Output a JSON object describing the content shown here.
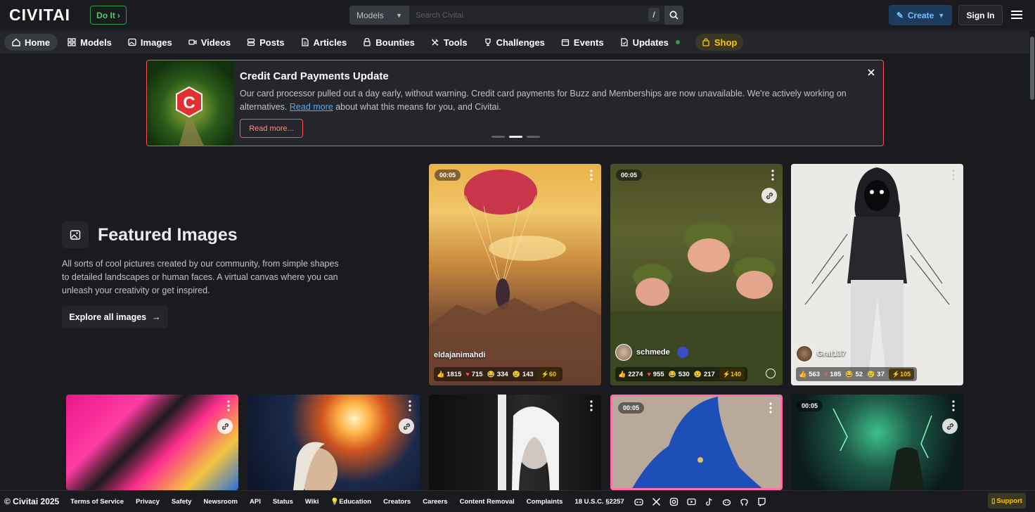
{
  "header": {
    "logo_text": "CIVITAI",
    "doit_label": "Do It",
    "search_category": "Models",
    "search_placeholder": "Search Civitai",
    "search_shortcut": "/",
    "create_label": "Create",
    "signin_label": "Sign In"
  },
  "nav": {
    "items": [
      {
        "label": "Home",
        "icon": "home-icon"
      },
      {
        "label": "Models",
        "icon": "models-icon"
      },
      {
        "label": "Images",
        "icon": "image-icon"
      },
      {
        "label": "Videos",
        "icon": "video-icon"
      },
      {
        "label": "Posts",
        "icon": "posts-icon"
      },
      {
        "label": "Articles",
        "icon": "article-icon"
      },
      {
        "label": "Bounties",
        "icon": "bounty-icon"
      },
      {
        "label": "Tools",
        "icon": "tools-icon"
      },
      {
        "label": "Challenges",
        "icon": "trophy-icon"
      },
      {
        "label": "Events",
        "icon": "calendar-icon"
      },
      {
        "label": "Updates",
        "icon": "updates-icon"
      }
    ],
    "shop_label": "Shop"
  },
  "banner": {
    "title": "Credit Card Payments Update",
    "text_before": "Our card processor pulled out a day early, without warning. Credit card payments for Buzz and Memberships are now unavailable. We're actively working on alternatives.",
    "link_text": "Read more",
    "text_after": "about what this means for you, and Civitai.",
    "button_label": "Read more...",
    "logo_letter": "C"
  },
  "featured": {
    "title": "Featured Images",
    "description": "All sorts of cool pictures created by our community, from simple shapes to detailed landscapes or human faces. A virtual canvas where you can unleash your creativity or get inspired.",
    "explore_label": "Explore all images"
  },
  "cards": [
    {
      "time": "00:05",
      "user": "eldajanimahdi",
      "likes": "1815",
      "hearts": "715",
      "laughs": "334",
      "cries": "143",
      "buzz": "60"
    },
    {
      "time": "00:05",
      "user": "schmede",
      "likes": "2274",
      "hearts": "955",
      "laughs": "530",
      "cries": "217",
      "buzz": "140"
    },
    {
      "user": "Graf137",
      "likes": "563",
      "hearts": "185",
      "laughs": "52",
      "cries": "37",
      "buzz": "105"
    }
  ],
  "cards_row2_times": [
    "00:05",
    "00:05"
  ],
  "footer": {
    "copyright": "© Civitai 2025",
    "links": [
      "Terms of Service",
      "Privacy",
      "Safety",
      "Newsroom",
      "API",
      "Status",
      "Wiki",
      "Education",
      "Creators",
      "Careers",
      "Content Removal",
      "Complaints",
      "18 U.S.C. §2257"
    ],
    "support_label": "Support"
  },
  "colors": {
    "accent": "#4dabf7",
    "alert": "#fa5252",
    "shop": "#fcc419",
    "online": "#2f9e44"
  }
}
